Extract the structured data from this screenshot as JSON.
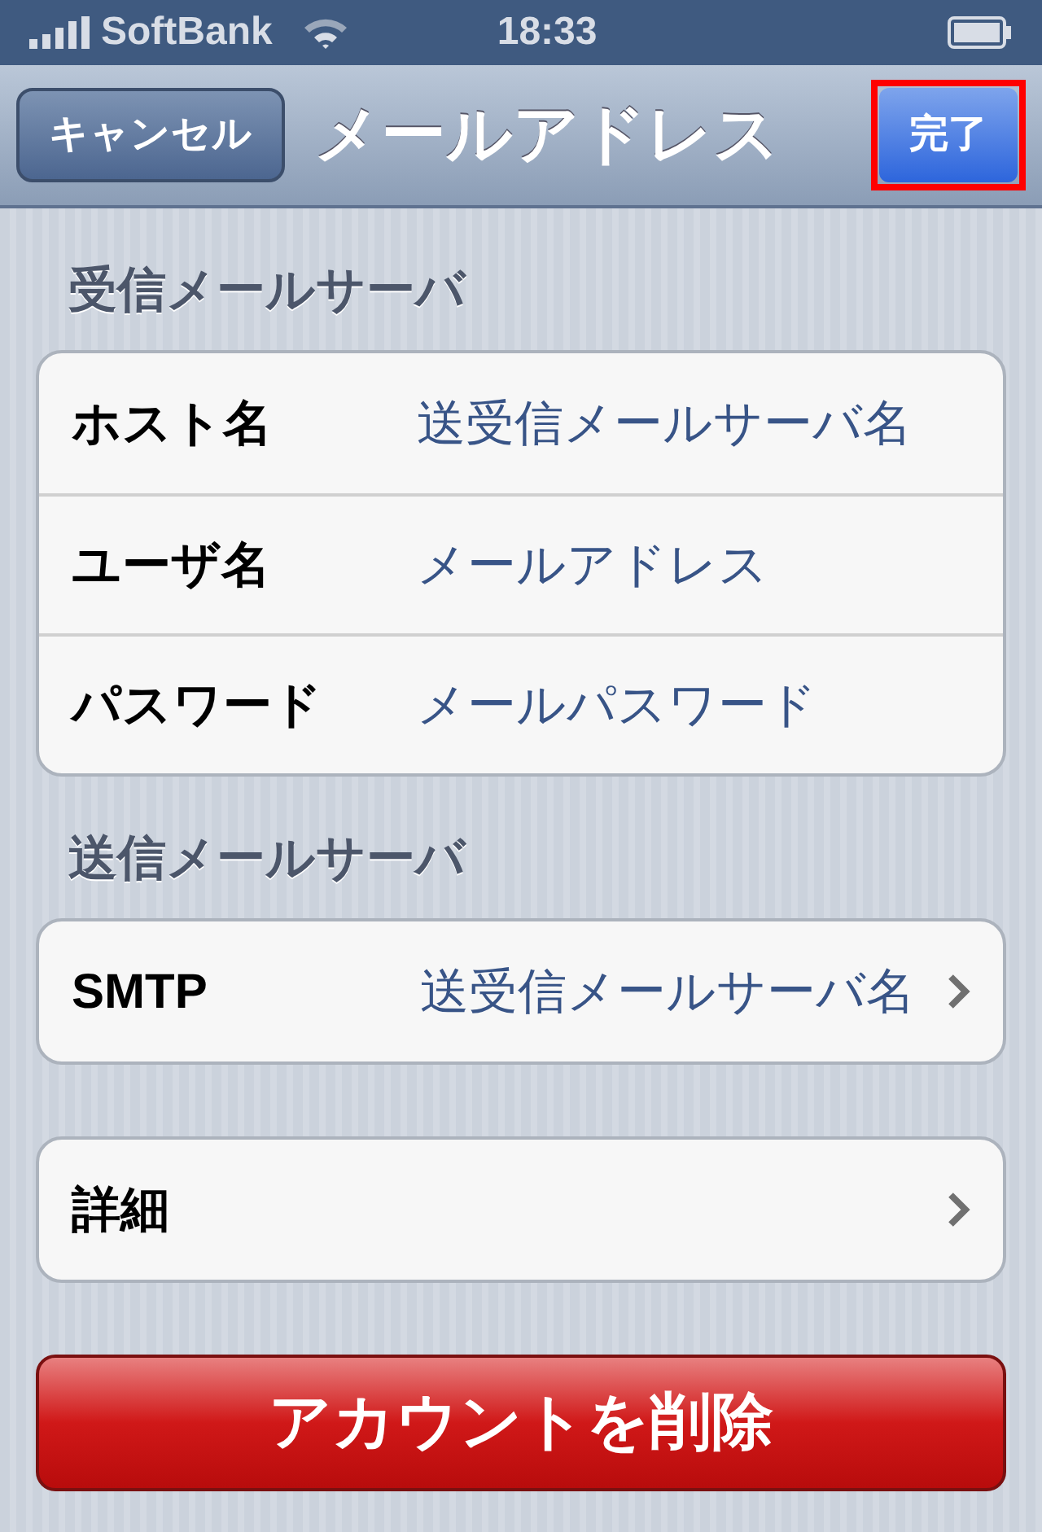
{
  "status_bar": {
    "carrier": "SoftBank",
    "time": "18:33"
  },
  "nav_bar": {
    "cancel": "キャンセル",
    "title": "メールアドレス",
    "done": {
      "label": "完了",
      "highlighted": true
    }
  },
  "sections": [
    {
      "header": "受信メールサーバ",
      "rows": [
        {
          "label": "ホスト名",
          "value": "送受信メールサーバ名",
          "chevron": false
        },
        {
          "label": "ユーザ名",
          "value": "メールアドレス",
          "chevron": false
        },
        {
          "label": "パスワード",
          "value": "メールパスワード",
          "chevron": false
        }
      ]
    },
    {
      "header": "送信メールサーバ",
      "rows": [
        {
          "label": "SMTP",
          "value": "送受信メールサーバ名",
          "chevron": true
        }
      ]
    },
    {
      "rows": [
        {
          "label": "詳細",
          "chevron": true
        }
      ]
    }
  ],
  "delete_button": "アカウントを削除"
}
